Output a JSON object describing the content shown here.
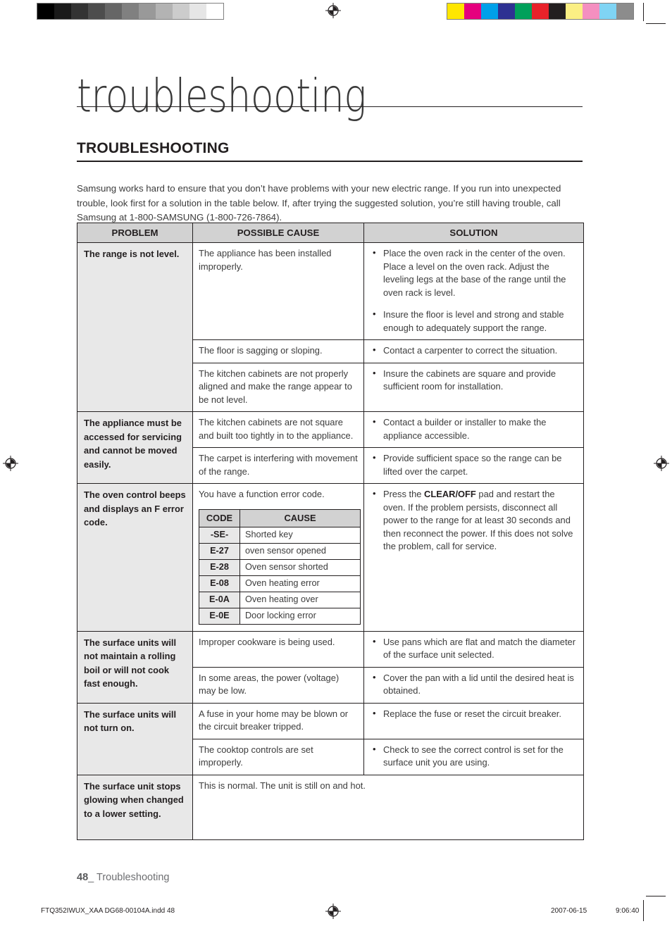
{
  "printer_marks": {
    "gray_wedge": [
      "#000000",
      "#1a1a1a",
      "#333333",
      "#4d4d4d",
      "#666666",
      "#808080",
      "#999999",
      "#b3b3b3",
      "#cccccc",
      "#e6e6e6",
      "#ffffff"
    ],
    "color_bars": [
      "#ffe600",
      "#e5007e",
      "#00a0e9",
      "#2e3192",
      "#00a05a",
      "#e8222a",
      "#231f20",
      "#fbef84",
      "#f48fc0",
      "#7fd4f4",
      "#8c8c8c"
    ]
  },
  "header": {
    "chapter_title": "troubleshooting",
    "section_title": "TROUBLESHOOTING",
    "intro": "Samsung works hard to ensure that you don’t have problems with your new electric range. If you run into unexpected trouble, look first for a solution in the table below. If, after trying the suggested solution, you’re still having trouble, call Samsung at 1-800-SAMSUNG (1-800-726-7864)."
  },
  "table": {
    "columns": [
      "PROBLEM",
      "POSSIBLE CAUSE",
      "SOLUTION"
    ],
    "rows": [
      {
        "problem": "The range is not level.",
        "cause": "The appliance has been installed improperly.",
        "solutions": [
          "Place the oven rack in the center of the oven. Place a level on the oven rack. Adjust the leveling legs at the base of the range until the oven rack is level.",
          "Insure the floor is level and strong and stable enough to adequately support the range."
        ]
      },
      {
        "problem": "",
        "cause": "The floor is sagging or sloping.",
        "solutions": [
          "Contact a carpenter to correct the situation."
        ]
      },
      {
        "problem": "",
        "cause": "The kitchen cabinets are not properly aligned and make the range appear to be not level.",
        "solutions": [
          "Insure the cabinets are square and provide sufficient room for installation."
        ]
      },
      {
        "problem": "The appliance must be accessed for servicing and cannot be moved easily.",
        "cause": "The kitchen cabinets are not square and built too tightly in to the appliance.",
        "solutions": [
          "Contact a builder or installer to make the appliance accessible."
        ]
      },
      {
        "problem": "",
        "cause": "The carpet is interfering with movement of the range.",
        "solutions": [
          "Provide sufficient space so the range can be lifted over the carpet."
        ]
      },
      {
        "problem": "The oven control beeps and displays an F error code.",
        "cause": "You have a function error code.",
        "solution_prefix": "Press the ",
        "solution_bold": "CLEAR/OFF",
        "solution_suffix": " pad and restart the oven. If the problem persists, disconnect all power to the range for at least 30 seconds and then reconnect the power. If this does not solve the problem, call for service."
      },
      {
        "problem": "The surface units will not maintain a rolling boil or will not cook fast enough.",
        "cause": "Improper cookware is being used.",
        "solutions": [
          "Use pans which are flat and match the diameter of the surface unit selected."
        ]
      },
      {
        "problem": "",
        "cause": "In some areas, the power (voltage) may be low.",
        "solutions": [
          "Cover the pan with a lid until the desired heat is obtained."
        ]
      },
      {
        "problem": "The surface units will not turn on.",
        "cause": "A fuse in your home may be blown or the circuit breaker tripped.",
        "solutions": [
          "Replace the fuse or reset the circuit breaker."
        ]
      },
      {
        "problem": "",
        "cause": "The cooktop controls are set improperly.",
        "solutions": [
          "Check to see the correct control is set for the surface unit you are using."
        ]
      },
      {
        "problem": "The surface unit stops glowing when changed to a lower setting.",
        "cause_merged": "This is normal. The unit is still on and hot."
      }
    ]
  },
  "code_table": {
    "columns": [
      "CODE",
      "CAUSE"
    ],
    "rows": [
      {
        "code": "-SE-",
        "cause": "Shorted key"
      },
      {
        "code": "E-27",
        "cause": "oven sensor opened"
      },
      {
        "code": "E-28",
        "cause": "Oven sensor shorted"
      },
      {
        "code": "E-08",
        "cause": "Oven heating error"
      },
      {
        "code": "E-0A",
        "cause": "Oven heating over"
      },
      {
        "code": "E-0E",
        "cause": "Door locking error"
      }
    ]
  },
  "footer": {
    "page_number": "48",
    "page_separator": "_",
    "page_label": "Troubleshooting",
    "file_name": "FTQ352IWUX_XAA DG68-00104A.indd   48",
    "date": "2007-06-15",
    "time": "9:06:40"
  }
}
